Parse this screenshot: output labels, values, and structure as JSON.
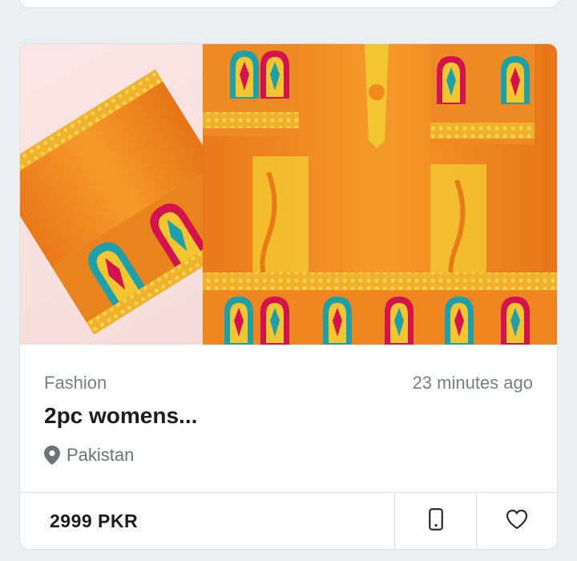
{
  "listing": {
    "category": "Fashion",
    "time_ago": "23 minutes ago",
    "title": "2pc womens...",
    "location": "Pakistan",
    "price": "2999 PKR"
  },
  "colors": {
    "accent": "#1d1d1f",
    "fabric_orange": "#f08a1c",
    "gold": "#f3c531",
    "teal": "#1ea0a8",
    "magenta": "#d4124e"
  },
  "icons": {
    "location": "map-pin-icon",
    "call": "mobile-phone-icon",
    "favorite": "heart-icon"
  }
}
